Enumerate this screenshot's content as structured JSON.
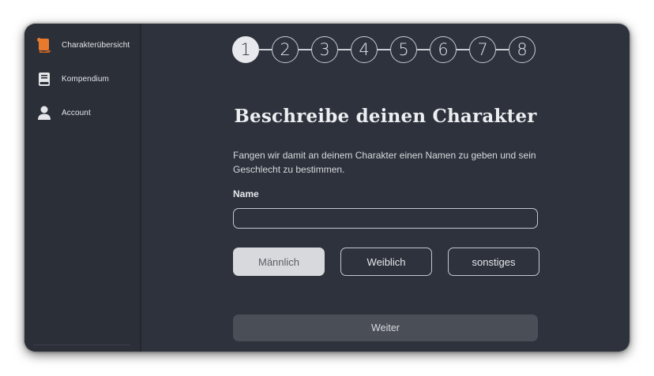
{
  "sidebar": {
    "items": [
      {
        "label": "Charakterübersicht",
        "icon": "scroll-icon",
        "icon_color": "#e87a2e"
      },
      {
        "label": "Kompendium",
        "icon": "book-icon",
        "icon_color": "#e4e6ea"
      },
      {
        "label": "Account",
        "icon": "user-icon",
        "icon_color": "#e4e6ea"
      }
    ]
  },
  "stepper": {
    "steps": [
      "1",
      "2",
      "3",
      "4",
      "5",
      "6",
      "7",
      "8"
    ],
    "active_step": 1
  },
  "main": {
    "title": "Beschreibe deinen Charakter",
    "description": "Fangen wir damit an deinem Charakter einen Namen zu geben und sein Geschlecht zu bestimmen.",
    "name_label": "Name",
    "name_value": "",
    "gender_options": [
      "Männlich",
      "Weiblich",
      "sonstiges"
    ],
    "selected_gender": "Männlich",
    "next_label": "Weiter"
  },
  "colors": {
    "background": "#2d323c",
    "sidebar": "#2b2f38",
    "accent": "#e87a2e",
    "selected_button": "#d8d9dc",
    "next_button": "#4a4e57"
  }
}
